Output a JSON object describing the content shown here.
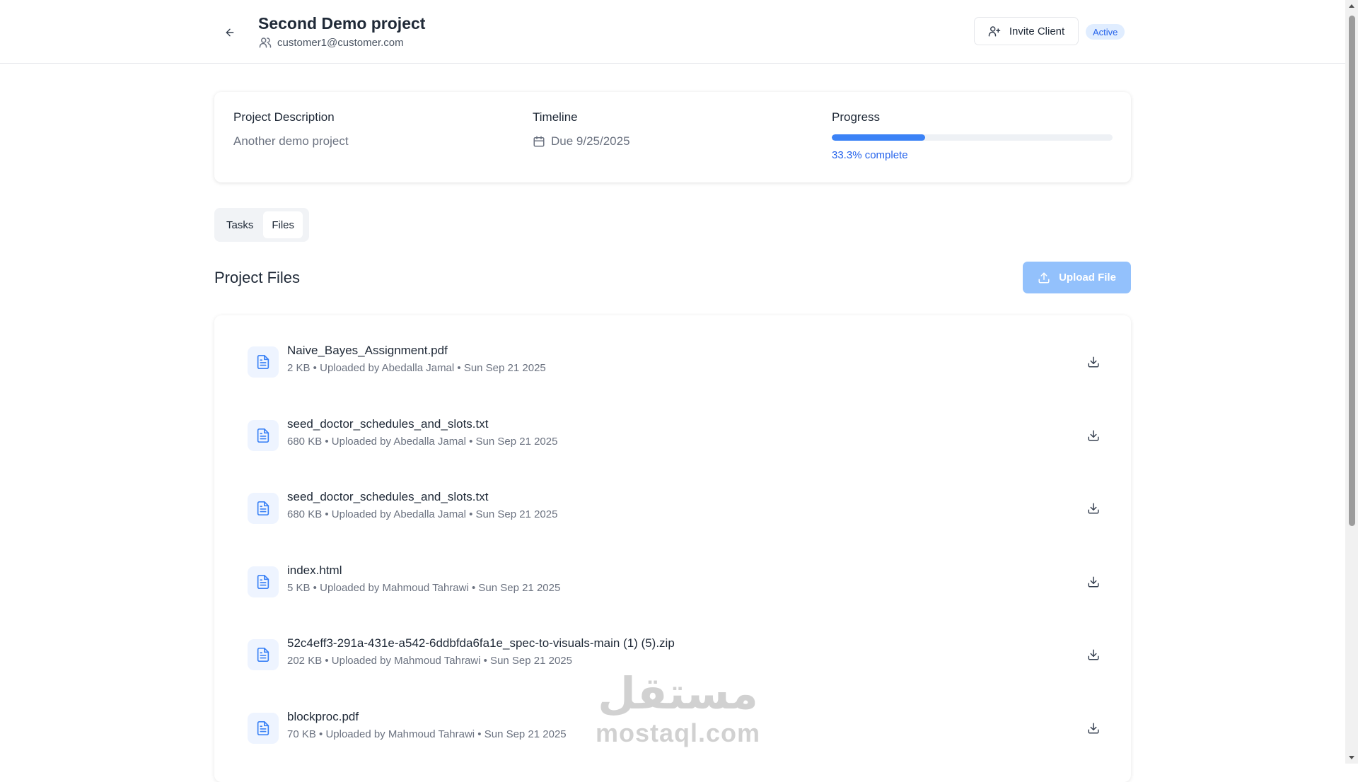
{
  "header": {
    "title": "Second Demo project",
    "client_email": "customer1@customer.com",
    "invite_label": "Invite Client",
    "status": "Active"
  },
  "info": {
    "description_label": "Project Description",
    "description_value": "Another demo project",
    "timeline_label": "Timeline",
    "timeline_value": "Due 9/25/2025",
    "progress_label": "Progress",
    "progress_text": "33.3% complete",
    "progress_fraction": 0.333
  },
  "tabs": [
    {
      "label": "Tasks",
      "active": false
    },
    {
      "label": "Files",
      "active": true
    }
  ],
  "files_section": {
    "title": "Project Files",
    "upload_label": "Upload File",
    "files": [
      {
        "name": "Naive_Bayes_Assignment.pdf",
        "meta": "2 KB • Uploaded by Abedalla Jamal • Sun Sep 21 2025"
      },
      {
        "name": "seed_doctor_schedules_and_slots.txt",
        "meta": "680 KB • Uploaded by Abedalla Jamal • Sun Sep 21 2025"
      },
      {
        "name": "seed_doctor_schedules_and_slots.txt",
        "meta": "680 KB • Uploaded by Abedalla Jamal • Sun Sep 21 2025"
      },
      {
        "name": "index.html",
        "meta": "5 KB • Uploaded by Mahmoud Tahrawi • Sun Sep 21 2025"
      },
      {
        "name": "52c4eff3-291a-431e-a542-6ddbfda6fa1e_spec-to-visuals-main (1) (5).zip",
        "meta": "202 KB • Uploaded by Mahmoud Tahrawi • Sun Sep 21 2025"
      },
      {
        "name": "blockproc.pdf",
        "meta": "70 KB • Uploaded by Mahmoud Tahrawi • Sun Sep 21 2025"
      }
    ]
  },
  "watermark": {
    "arabic": "مستقل",
    "latin": "mostaql.com"
  },
  "colors": {
    "accent": "#3b82f6",
    "upload_button": "#93c1fc",
    "badge_bg": "#e0edff"
  }
}
